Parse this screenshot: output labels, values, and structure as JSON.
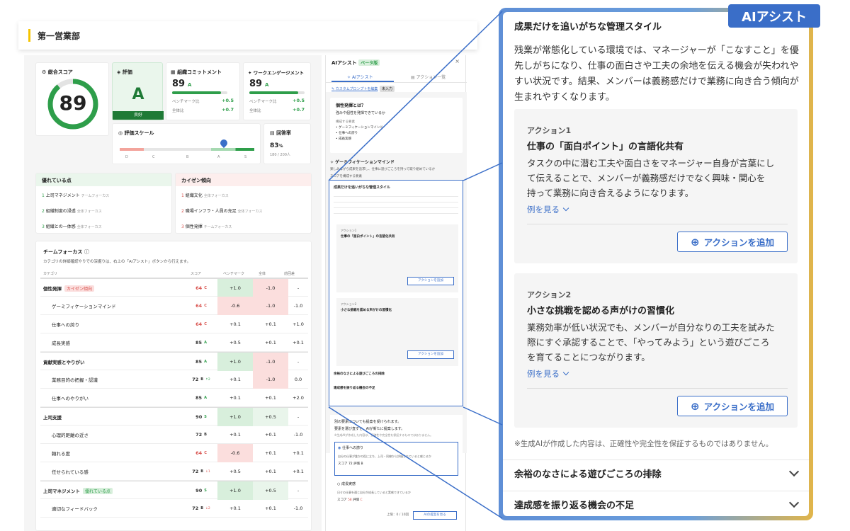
{
  "header": {
    "department": "第一営業部"
  },
  "score": {
    "label": "総合スコア",
    "value": "89"
  },
  "rating": {
    "label": "評価",
    "grade": "A",
    "caption": "良好"
  },
  "commitment": {
    "label": "組織コミットメント",
    "value": "89",
    "grade": "A",
    "bench_label": "ベンチマーク比",
    "bench_delta": "+0.5",
    "all_label": "全体比",
    "all_delta": "+0.7"
  },
  "engagement": {
    "label": "ワークエンゲージメント",
    "value": "89",
    "grade": "A",
    "bench_label": "ベンチマーク比",
    "bench_delta": "+0.5",
    "all_label": "全体比",
    "all_delta": "+0.7"
  },
  "scale": {
    "label": "評価スケール",
    "ticks": [
      "D",
      "C",
      "B",
      "A",
      "S"
    ]
  },
  "response": {
    "label": "回答率",
    "value": "83",
    "unit": "%",
    "detail": "180 / 200人"
  },
  "strengths": {
    "title": "優れている点",
    "items": [
      {
        "n": "1",
        "name": "上司マネジメント",
        "focus": "チームフォーカス"
      },
      {
        "n": "2",
        "name": "組織制度の浸透",
        "focus": "全体フォーカス"
      },
      {
        "n": "3",
        "name": "組織との一体感",
        "focus": "全体フォーカス"
      }
    ]
  },
  "kaizen": {
    "title": "カイゼン傾向",
    "items": [
      {
        "n": "1",
        "name": "組織文化",
        "focus": "全体フォーカス"
      },
      {
        "n": "2",
        "name": "職場インフラ・人員の充足",
        "focus": "全体フォーカス"
      },
      {
        "n": "3",
        "name": "個性発揮",
        "focus": "チームフォーカス"
      }
    ]
  },
  "team": {
    "title": "チームフォーカス",
    "desc": "カテゴリの詳細確認やりでの深掘りは、右上の「AIアシスト」ボタンから行えます。",
    "columns": [
      "カテゴリ",
      "スコア",
      "ベンチマーク",
      "全体",
      "前回差"
    ],
    "rows": [
      {
        "name": "個性発揮",
        "tag": "カイゼン傾向",
        "score": "64",
        "g": "C",
        "bench": "+1.0",
        "all": "-1.0",
        "prev": "-",
        "bold": true
      },
      {
        "name": "ゲーミフィケーションマインド",
        "score": "64",
        "g": "C",
        "bench": "-0.6",
        "all": "-1.0",
        "prev": "-1.0",
        "indent": true
      },
      {
        "name": "仕事への誇り",
        "score": "64",
        "g": "C",
        "bench": "+0.1",
        "all": "+0.1",
        "prev": "+1.0",
        "indent": true
      },
      {
        "name": "成長実感",
        "score": "85",
        "g": "A",
        "bench": "+0.5",
        "all": "+0.1",
        "prev": "+0.1",
        "indent": true
      },
      {
        "name": "貢献実感とやりがい",
        "score": "85",
        "g": "A",
        "bench": "+1.0",
        "all": "-1.0",
        "prev": "-",
        "bold": true
      },
      {
        "name": "業務目的の把握・認識",
        "score": "72",
        "g": "B",
        "trend": "↑2",
        "bench": "+0.1",
        "all": "-1.0",
        "prev": "0.0",
        "indent": true
      },
      {
        "name": "仕事へのやりがい",
        "score": "85",
        "g": "A",
        "bench": "+0.1",
        "all": "+0.1",
        "prev": "+2.0",
        "indent": true
      },
      {
        "name": "上司支援",
        "score": "90",
        "g": "S",
        "bench": "+1.0",
        "all": "+0.5",
        "prev": "-",
        "bold": true
      },
      {
        "name": "心理的距離の近さ",
        "score": "72",
        "g": "B",
        "bench": "+0.1",
        "all": "+0.1",
        "prev": "-1.0",
        "indent": true
      },
      {
        "name": "頼れる度",
        "score": "64",
        "g": "C",
        "bench": "-0.6",
        "all": "+0.1",
        "prev": "+0.1",
        "indent": true
      },
      {
        "name": "任せられている感",
        "score": "72",
        "g": "B",
        "trend": "↓1",
        "bench": "+0.5",
        "all": "+0.1",
        "prev": "+0.1",
        "indent": true
      },
      {
        "name": "上司マネジメント",
        "tag": "優れている点",
        "score": "90",
        "g": "S",
        "bench": "+1.0",
        "all": "+0.5",
        "prev": "-",
        "bold": true
      },
      {
        "name": "適切なフィードバック",
        "score": "72",
        "g": "B",
        "trend": "↓2",
        "bench": "+0.1",
        "all": "+0.1",
        "prev": "-1.0",
        "indent": true
      }
    ]
  },
  "panel": {
    "title": "AIアシスト",
    "beta": "ベータ版",
    "tab1": "AIアシスト",
    "tab2": "アクション一覧",
    "prompt_link": "カスタムプロンプトを編集",
    "prompt_state": "未入力",
    "q_title": "個性発揮とは？",
    "q_sub": "強みや個性を発揮できているか",
    "q_items_label": "構成する要素",
    "q_items": [
      "ゲーミフィケーションマインド",
      "仕事への誇り",
      "成長実感"
    ],
    "g_title": "ゲーミフィケーションマインド",
    "g_desc": "楽しみながら成果を追求し、仕事に遊びごころを持って取り組めているか",
    "g_sub": "スコアを構成する要素",
    "mini_bottom1": "別の要素についても提案を受けられます。",
    "mini_bottom2": "要素を選び直すと、AIが新たに提案します。",
    "mini_note": "※生成AIが作成した内容は、正確性や完全性を保証するものではありません。",
    "opt1": "仕事への誇り",
    "opt1_desc": "自分の仕事が誰かの役に立ち、上司・同僚から評価されていると感じるか",
    "opt1_score": "72",
    "opt1_g": "B",
    "opt2": "成長実感",
    "opt2_desc": "日々の仕事を通じ自分が成長していると実感できているか",
    "opt2_score": "58",
    "opt2_g": "C",
    "limit": "上限：0 / 10回",
    "ai_btn": "AIの提案を見る",
    "score_lbl": "スコア",
    "grade_lbl": "評価"
  },
  "zoom": {
    "badge": "AIアシスト",
    "section_title": "成果だけを追いがちな管理スタイル",
    "section_body": [
      "残業が常態化している環境では、マネージャーが「こなすこと」を優",
      "先しがちになり、仕事の面白さや工夫の余地を伝える機会が失われや",
      "すい状況です。結果、メンバーは義務感だけで業務に向き合う傾向が",
      "生まれやすくなります。"
    ],
    "actions": [
      {
        "label": "アクション1",
        "title": "仕事の「面白ポイント」の言語化共有",
        "body": [
          "タスクの中に潜む工夫や面白さをマネージャー自身が言葉にし",
          "て伝えることで、メンバーが義務感だけでなく興味・関心を",
          "持って業務に向き合えるようになります。"
        ],
        "example": "例を見る",
        "add": "アクションを追加"
      },
      {
        "label": "アクション2",
        "title": "小さな挑戦を認める声がけの習慣化",
        "body": [
          "業務効率が低い状況でも、メンバーが自分なりの工夫を試みた",
          "際にすぐ承認することで、「やってみよう」という遊びごころ",
          "を育てることにつながります。"
        ],
        "example": "例を見る",
        "add": "アクションを追加"
      }
    ],
    "disclaimer": "※生成AIが作成した内容は、正確性や完全性を保証するものではありません。",
    "acc1": "余裕のなさによる遊びごころの排除",
    "acc2": "達成感を振り返る機会の不足"
  }
}
